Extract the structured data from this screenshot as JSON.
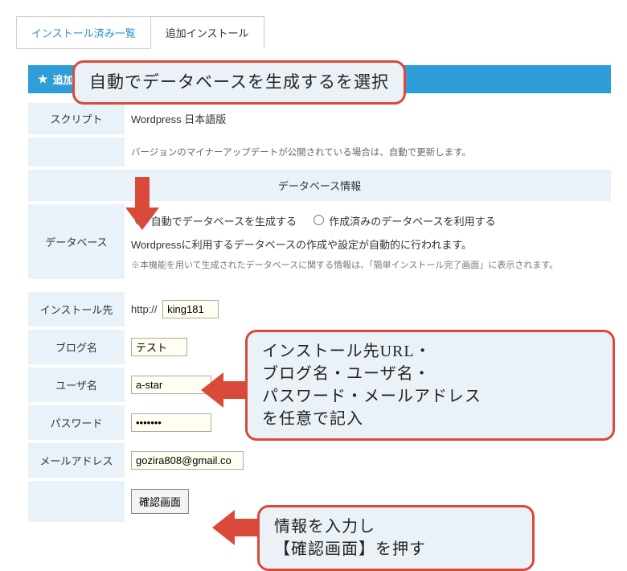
{
  "tabs": {
    "installed": "インストール済み一覧",
    "add": "追加インストール"
  },
  "panel_title": "追加インストール",
  "rows": {
    "script_label": "スクリプト",
    "script_value": "Wordpress 日本語版",
    "auto_update_note": "バージョンのマイナーアップデートが公開されている場合は、自動で更新します。",
    "db_section_title": "データベース情報",
    "db_label": "データベース",
    "db_radio_auto": "自動でデータベースを生成する",
    "db_radio_existing": "作成済みのデータベースを利用する",
    "db_desc": "Wordpressに利用するデータベースの作成や設定が自動的に行われます。",
    "db_note": "※本機能を用いて生成されたデータベースに関する情報は、「簡単インストール完了画面」に表示されます。",
    "install_label": "インストール先",
    "url_prefix": "http://",
    "url_value": "king181",
    "blog_label": "ブログ名",
    "blog_value": "テスト",
    "user_label": "ユーザ名",
    "user_value": "a-star",
    "pass_label": "パスワード",
    "pass_value": "•••••••",
    "mail_label": "メールアドレス",
    "mail_value": "gozira808@gmail.co",
    "confirm_button": "確認画面"
  },
  "callouts": {
    "top": "自動でデータベースを生成するを選択",
    "mid_l1": "インストール先URL・",
    "mid_l2": "ブログ名・ユーザ名・",
    "mid_l3": "パスワード・メールアドレス",
    "mid_l4": "を任意で記入",
    "bot_l1": "情報を入力し",
    "bot_l2": "【確認画面】を押す"
  }
}
